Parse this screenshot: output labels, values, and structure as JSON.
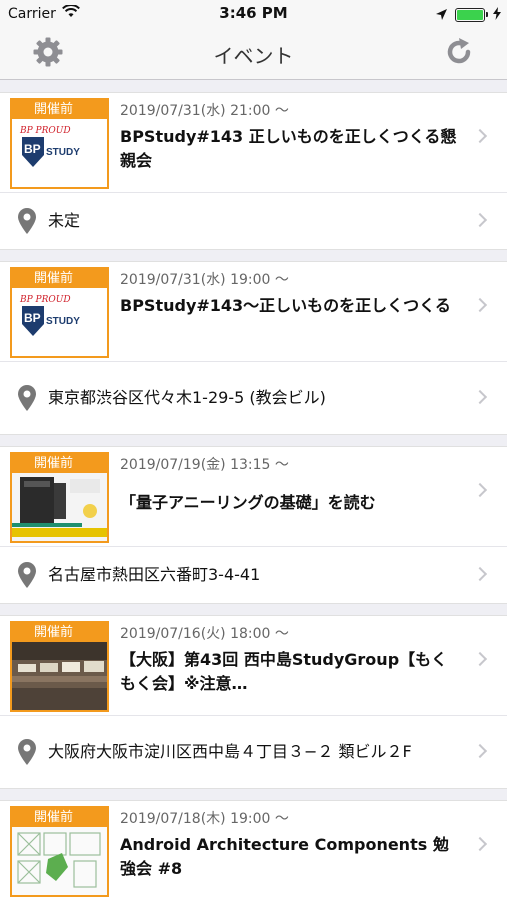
{
  "status_bar": {
    "carrier": "Carrier",
    "time": "3:46 PM"
  },
  "nav": {
    "title": "イベント",
    "left_icon": "gear-icon",
    "right_icon": "refresh-icon"
  },
  "events": [
    {
      "badge": "開催前",
      "date": "2019/07/31(水) 21:00 〜",
      "title": "BPStudy#143 正しいものを正しくつくる懇親会",
      "location": "未定",
      "thumb": "bpstudy-logo"
    },
    {
      "badge": "開催前",
      "date": "2019/07/31(水) 19:00 〜",
      "title": "BPStudy#143〜正しいものを正しくつくる",
      "location": "東京都渋谷区代々木1-29-5 (教会ビル)",
      "thumb": "bpstudy-logo"
    },
    {
      "badge": "開催前",
      "date": "2019/07/19(金) 13:15 〜",
      "title": "「量子アニーリングの基礎」を読む",
      "location": "名古屋市熱田区六番町3-4-41",
      "thumb": "book-cover"
    },
    {
      "badge": "開催前",
      "date": "2019/07/16(火) 18:00 〜",
      "title": "【大阪】第43回 西中島StudyGroup【もくもく会】※注意…",
      "location": "大阪府大阪市淀川区西中島４丁目３−２ 類ビル２F",
      "thumb": "building-photo"
    },
    {
      "badge": "開催前",
      "date": "2019/07/18(木) 19:00 〜",
      "title": "Android Architecture Components 勉強会 #8",
      "location": "",
      "thumb": "android-diagram"
    }
  ]
}
